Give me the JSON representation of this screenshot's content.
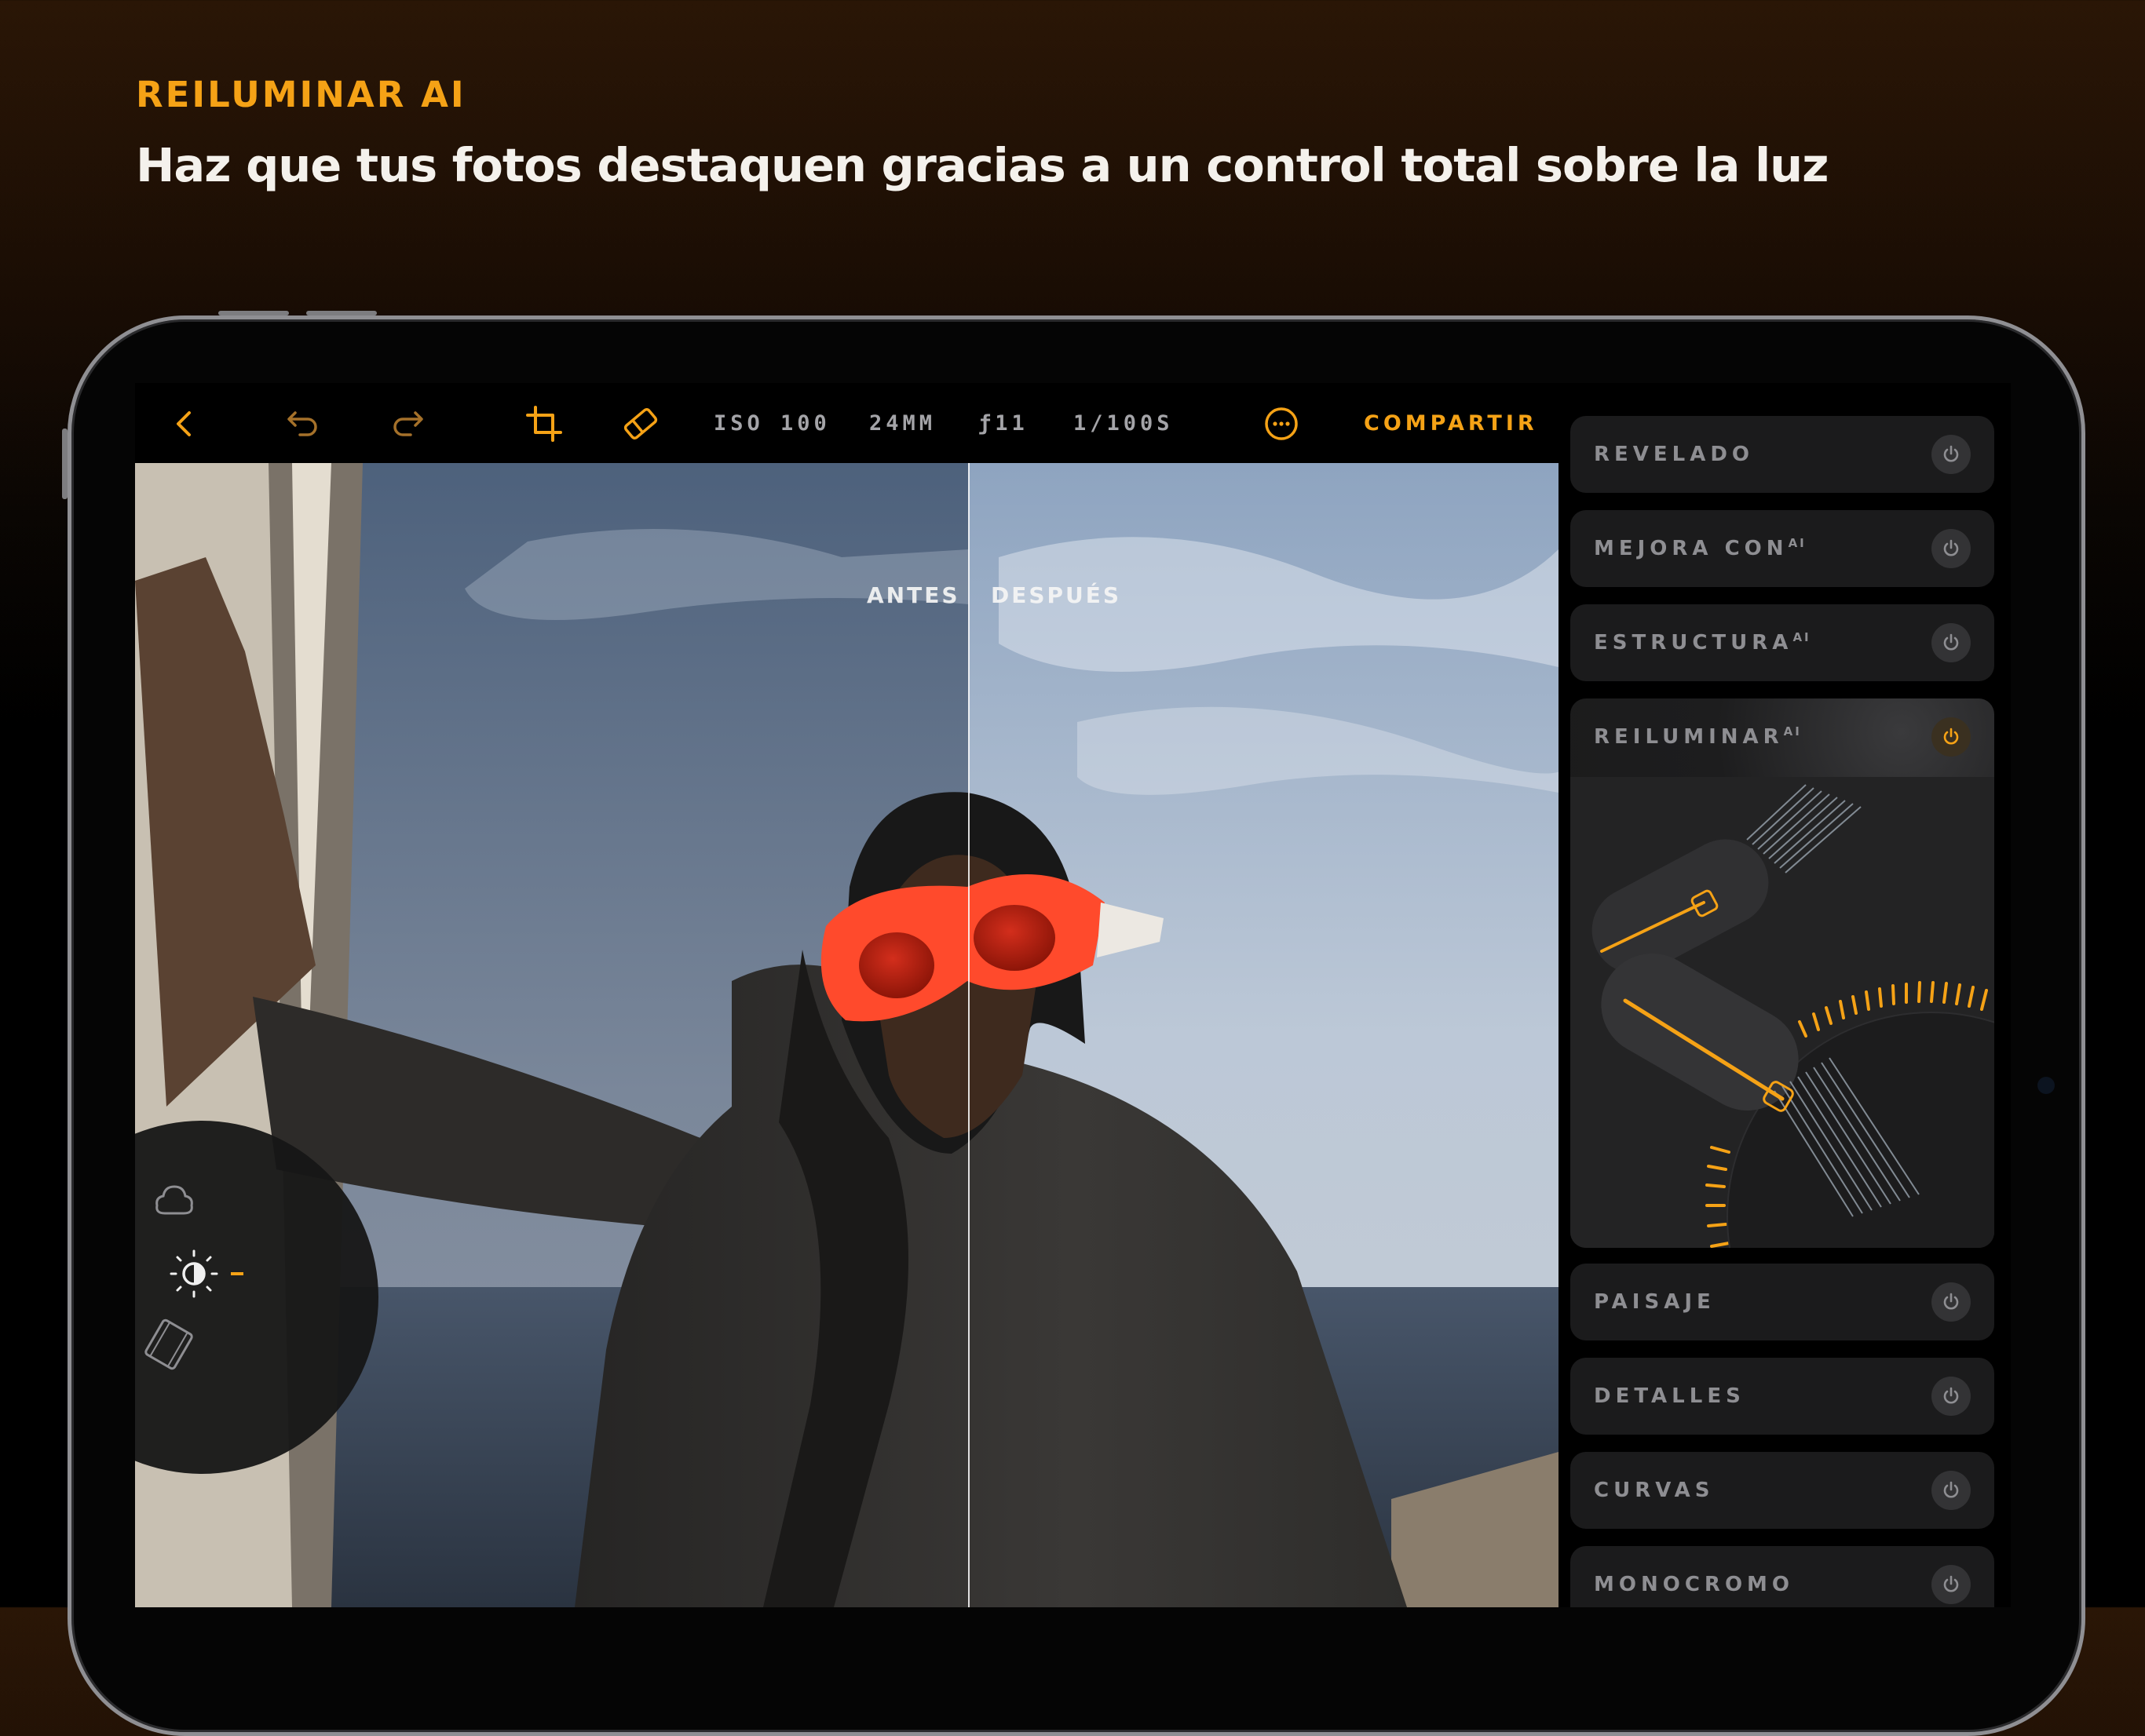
{
  "header": {
    "eyebrow": "REILUMINAR AI",
    "headline": "Haz que tus fotos destaquen gracias a un control total sobre la luz"
  },
  "toolbar": {
    "icons": [
      "back-icon",
      "undo-icon",
      "redo-icon",
      "crop-icon",
      "eraser-icon",
      "more-icon"
    ],
    "meta": {
      "iso": "ISO 100",
      "focal": "24MM",
      "aperture": "ƒ11",
      "shutter": "1/100S"
    },
    "share_label": "COMPARTIR"
  },
  "compare": {
    "before_label": "ANTES",
    "after_label": "DESPUÉS",
    "split_fraction": 0.586
  },
  "dial": {
    "icons": [
      "cloud-icon",
      "light-icon",
      "film-icon"
    ]
  },
  "panel": {
    "items": [
      {
        "label": "REVELADO",
        "ai": "",
        "active": false
      },
      {
        "label": "MEJORA CON",
        "ai": "AI",
        "active": false
      },
      {
        "label": "ESTRUCTURA",
        "ai": "AI",
        "active": false
      },
      {
        "label": "REILUMINAR",
        "ai": "AI",
        "active": true
      },
      {
        "label": "PAISAJE",
        "ai": "",
        "active": false
      },
      {
        "label": "DETALLES",
        "ai": "",
        "active": false
      },
      {
        "label": "CURVAS",
        "ai": "",
        "active": false
      },
      {
        "label": "MONOCROMO",
        "ai": "",
        "active": false
      }
    ]
  },
  "colors": {
    "accent": "#f5a216",
    "panel": "#1b1b1c",
    "text_muted": "#8e8e92"
  }
}
